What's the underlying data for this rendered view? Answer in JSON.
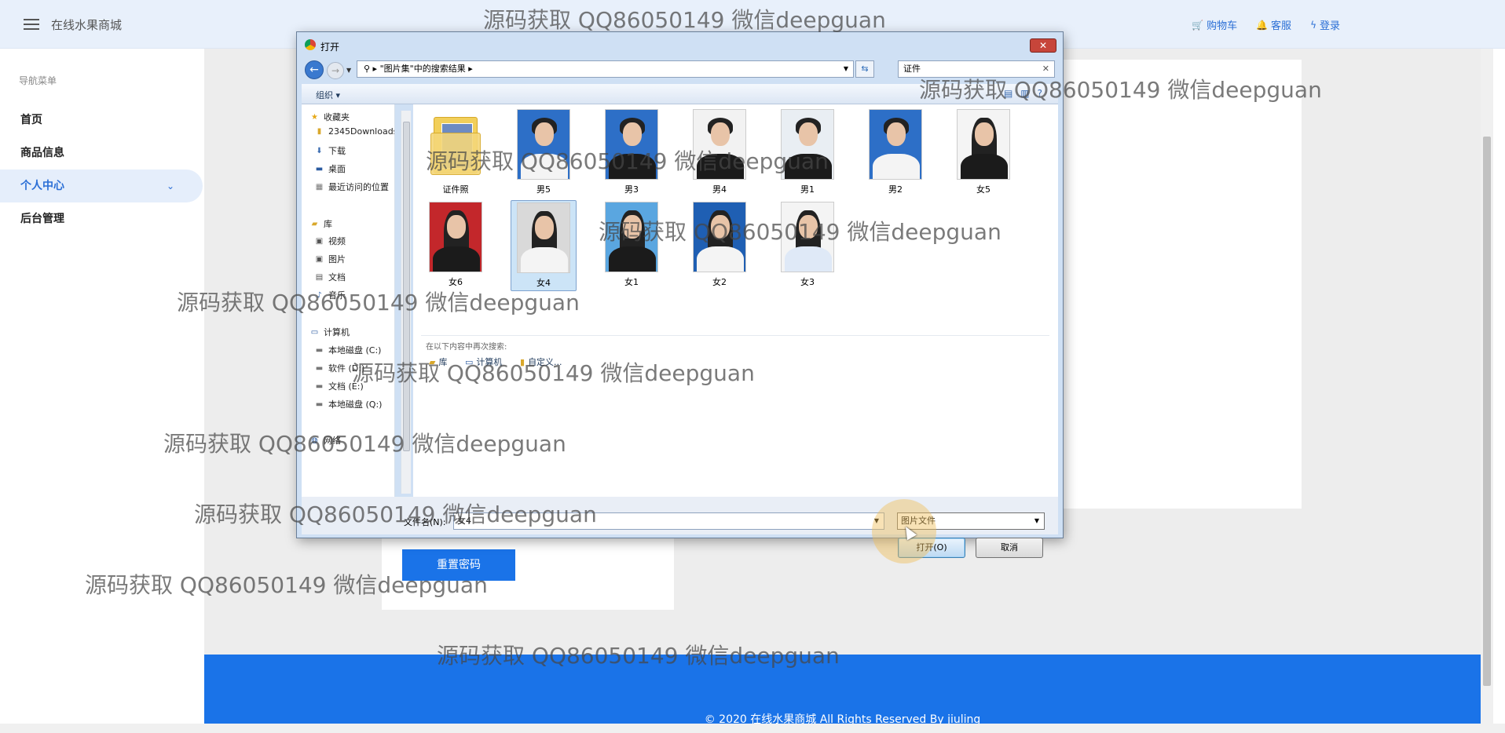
{
  "header": {
    "site_title": "在线水果商城",
    "links": [
      {
        "label": "购物车",
        "icon": "cart-icon"
      },
      {
        "label": "客服",
        "icon": "bell-icon"
      },
      {
        "label": "登录",
        "icon": "bolt-icon"
      }
    ]
  },
  "sidebar": {
    "title": "导航菜单",
    "items": [
      {
        "label": "首页"
      },
      {
        "label": "商品信息"
      },
      {
        "label": "个人中心",
        "active": true
      },
      {
        "label": "后台管理"
      }
    ]
  },
  "main": {
    "reset_button": "重置密码",
    "footer_text": "© 2020 在线水果商城 All Rights Reserved By jiuling"
  },
  "dialog": {
    "title": "打开",
    "close_label": "✕",
    "address": "\"图片集\"中的搜索结果",
    "search_value": "证件",
    "organize_label": "组织 ▾",
    "tree": {
      "favorites": "收藏夹",
      "fav_items": [
        "2345Downloads",
        "下载",
        "桌面",
        "最近访问的位置"
      ],
      "library": "库",
      "lib_items": [
        "视频",
        "图片",
        "文档",
        "音乐"
      ],
      "computer": "计算机",
      "drives": [
        "本地磁盘 (C:)",
        "软件 (D:)",
        "文档 (E:)",
        "本地磁盘 (Q:)"
      ],
      "network": "网络"
    },
    "files": [
      {
        "name": "证件照",
        "type": "folder"
      },
      {
        "name": "男5"
      },
      {
        "name": "男3"
      },
      {
        "name": "男4"
      },
      {
        "name": "男1"
      },
      {
        "name": "男2"
      },
      {
        "name": "女5"
      },
      {
        "name": "女6"
      },
      {
        "name": "女4",
        "selected": true
      },
      {
        "name": "女1"
      },
      {
        "name": "女2"
      },
      {
        "name": "女3"
      }
    ],
    "search_again_label": "在以下内容中再次搜索:",
    "search_locations": [
      "库",
      "计算机",
      "自定义..."
    ],
    "filename_label": "文件名(N):",
    "filename_value": "女4",
    "filetype_value": "图片文件",
    "open_button": "打开(O)",
    "cancel_button": "取消"
  },
  "watermark_text": "源码获取 QQ86050149 微信deepguan"
}
